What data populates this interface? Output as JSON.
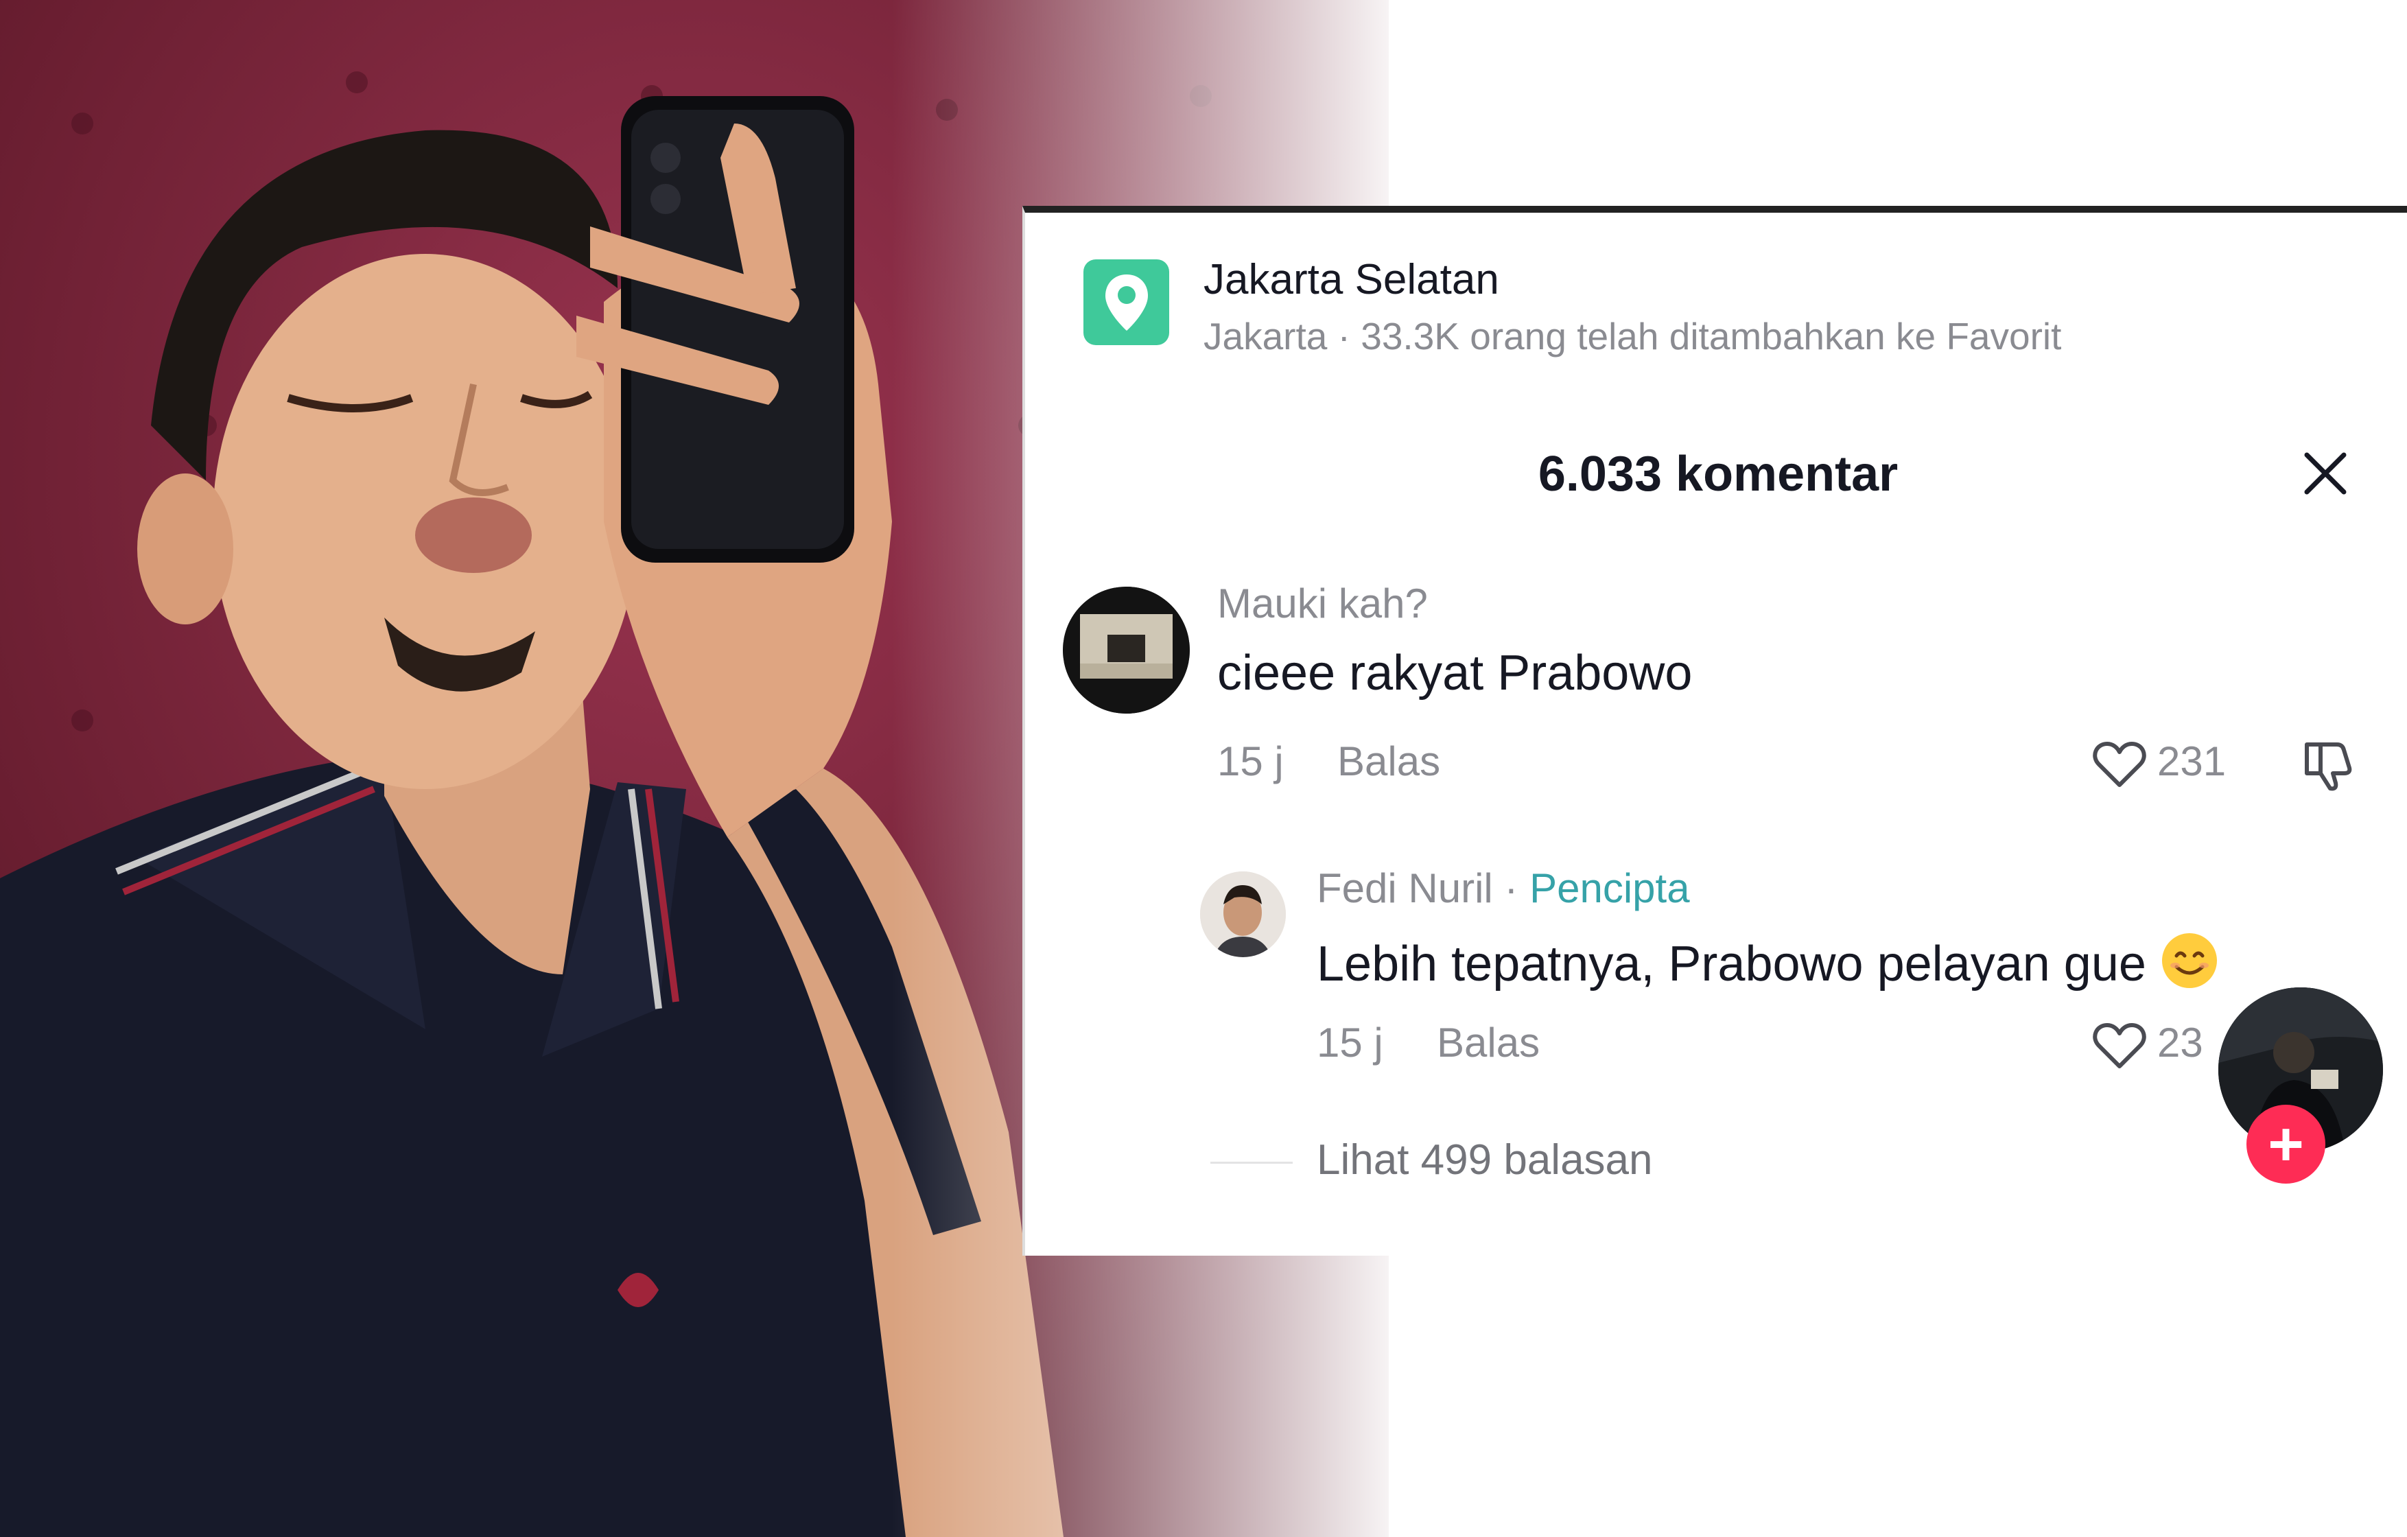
{
  "colors": {
    "location_icon": "#3fc99a",
    "creator_tag": "#36a2a8",
    "add_button": "#fe2c55",
    "muted_text": "#8a8b91",
    "primary_text": "#161823",
    "photo_background": "#7a2238"
  },
  "location": {
    "icon": "location-pin-icon",
    "title": "Jakarta Selatan",
    "subtitle": "Jakarta · 33.3K orang telah ditambahkan ke Favorit"
  },
  "comments_panel": {
    "title": "6.033 komentar",
    "close_icon": "close-icon"
  },
  "comments": [
    {
      "username": "Mauki kah?",
      "text": "cieee rakyat Prabowo",
      "time": "15 j",
      "reply_label": "Balas",
      "likes": "231"
    },
    {
      "username": "Fedi Nuril",
      "separator": " · ",
      "creator_tag": "Pencipta",
      "text": "Lebih tepatnya, Prabowo pelayan gue",
      "emoji": "smiling-face-emoji",
      "time": "15 j",
      "reply_label": "Balas",
      "likes": "23"
    }
  ],
  "view_replies": "Lihat 499 balasan",
  "floating_button": {
    "icon": "plus-icon",
    "label": "+"
  }
}
